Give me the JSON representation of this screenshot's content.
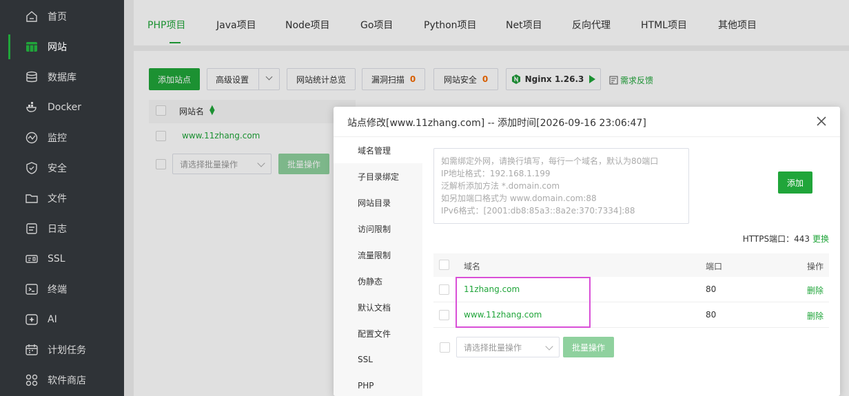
{
  "sidebar": {
    "items": [
      {
        "label": "首页",
        "icon": "home-icon"
      },
      {
        "label": "网站",
        "icon": "website-icon"
      },
      {
        "label": "数据库",
        "icon": "database-icon"
      },
      {
        "label": "Docker",
        "icon": "docker-icon"
      },
      {
        "label": "监控",
        "icon": "monitor-icon"
      },
      {
        "label": "安全",
        "icon": "shield-icon"
      },
      {
        "label": "文件",
        "icon": "folder-icon"
      },
      {
        "label": "日志",
        "icon": "log-icon"
      },
      {
        "label": "SSL",
        "icon": "ssl-icon"
      },
      {
        "label": "终端",
        "icon": "terminal-icon"
      },
      {
        "label": "AI",
        "icon": "ai-icon"
      },
      {
        "label": "计划任务",
        "icon": "calendar-icon"
      },
      {
        "label": "软件商店",
        "icon": "store-icon"
      }
    ],
    "active_index": 1
  },
  "tabs": [
    {
      "label": "PHP项目"
    },
    {
      "label": "Java项目"
    },
    {
      "label": "Node项目"
    },
    {
      "label": "Go项目"
    },
    {
      "label": "Python项目"
    },
    {
      "label": "Net项目"
    },
    {
      "label": "反向代理"
    },
    {
      "label": "HTML项目"
    },
    {
      "label": "其他项目"
    }
  ],
  "toolbar": {
    "add_site": "添加站点",
    "advanced": "高级设置",
    "stats": "网站统计总览",
    "vuln_scan": "漏洞扫描",
    "vuln_count": "0",
    "site_security": "网站安全",
    "security_count": "0",
    "nginx": "Nginx 1.26.3",
    "feedback": "需求反馈"
  },
  "site_table": {
    "col_name": "网站名",
    "rows": [
      {
        "name": "www.11zhang.com"
      }
    ],
    "batch_placeholder": "请选择批量操作",
    "batch_button": "批量操作"
  },
  "modal": {
    "title": "站点修改[www.11zhang.com] -- 添加时间[2026-09-16 23:06:47]",
    "nav": [
      "域名管理",
      "子目录绑定",
      "网站目录",
      "访问限制",
      "流量限制",
      "伪静态",
      "默认文档",
      "配置文件",
      "SSL",
      "PHP"
    ],
    "active_nav": 0,
    "textarea_placeholder": [
      "如需绑定外网，请换行填写，每行一个域名，默认为80端口",
      "IP地址格式：192.168.1.199",
      "泛解析添加方法 *.domain.com",
      "如另加端口格式为 www.domain.com:88",
      "IPv6格式：[2001:db8:85a3::8a2e:370:7334]:88"
    ],
    "add_button": "添加",
    "https_port_label": "HTTPS端口：443",
    "https_update": "更换",
    "table": {
      "col_domain": "域名",
      "col_port": "端口",
      "col_action": "操作",
      "rows": [
        {
          "domain": "11zhang.com",
          "port": "80",
          "action": "删除"
        },
        {
          "domain": "www.11zhang.com",
          "port": "80",
          "action": "删除"
        }
      ]
    },
    "batch_placeholder": "请选择批量操作",
    "batch_button": "批量操作"
  },
  "colors": {
    "accent": "#20a53a",
    "sidebar_bg": "#2f3337",
    "highlight": "#d94fd7",
    "warn": "#f56c00"
  }
}
